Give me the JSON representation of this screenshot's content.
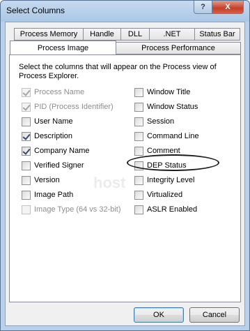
{
  "window": {
    "title": "Select Columns"
  },
  "titlebar": {
    "help_label": "?",
    "close_label": "X"
  },
  "tabs": {
    "row1": [
      "Process Memory",
      "Handle",
      "DLL",
      ".NET",
      "Status Bar"
    ],
    "row2": [
      "Process Image",
      "Process Performance"
    ],
    "active": "Process Image"
  },
  "panel": {
    "description": "Select the columns that will appear on the Process view of Process Explorer."
  },
  "left_column": [
    {
      "label": "Process Name",
      "checked": true,
      "disabled": true
    },
    {
      "label": "PID (Process Identifier)",
      "checked": true,
      "disabled": true
    },
    {
      "label": "User Name",
      "checked": false,
      "disabled": false
    },
    {
      "label": "Description",
      "checked": true,
      "disabled": false
    },
    {
      "label": "Company Name",
      "checked": true,
      "disabled": false
    },
    {
      "label": "Verified Signer",
      "checked": false,
      "disabled": false
    },
    {
      "label": "Version",
      "checked": false,
      "disabled": false
    },
    {
      "label": "Image Path",
      "checked": false,
      "disabled": false
    },
    {
      "label": "Image Type (64 vs 32-bit)",
      "checked": false,
      "disabled": true
    }
  ],
  "right_column": [
    {
      "label": "Window Title",
      "checked": false,
      "disabled": false
    },
    {
      "label": "Window Status",
      "checked": false,
      "disabled": false
    },
    {
      "label": "Session",
      "checked": false,
      "disabled": false
    },
    {
      "label": "Command Line",
      "checked": false,
      "disabled": false
    },
    {
      "label": "Comment",
      "checked": false,
      "disabled": false
    },
    {
      "label": "DEP Status",
      "checked": false,
      "disabled": false
    },
    {
      "label": "Integrity Level",
      "checked": false,
      "disabled": false
    },
    {
      "label": "Virtualized",
      "checked": false,
      "disabled": false
    },
    {
      "label": "ASLR Enabled",
      "checked": false,
      "disabled": false
    }
  ],
  "buttons": {
    "ok_label": "OK",
    "cancel_label": "Cancel"
  },
  "watermark": "host"
}
